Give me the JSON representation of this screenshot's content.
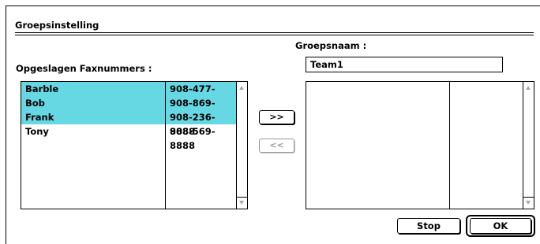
{
  "dialog": {
    "title": "Groepsinstelling"
  },
  "left_panel": {
    "label": "Opgeslagen Faxnummers :",
    "rows": [
      {
        "name": "Barble",
        "number": "908-477-8888",
        "selected": true
      },
      {
        "name": "Bob",
        "number": "908-869-8888",
        "selected": true
      },
      {
        "name": "Frank",
        "number": "908-236-8888",
        "selected": true
      },
      {
        "name": "Tony",
        "number": "908-569-8888",
        "selected": false
      }
    ],
    "selection_color": "#66d8e4"
  },
  "right_panel": {
    "label": "Groepsnaam :",
    "group_name": "Team1"
  },
  "buttons": {
    "add": ">>",
    "remove": "<<",
    "stop": "Stop",
    "ok": "OK"
  }
}
